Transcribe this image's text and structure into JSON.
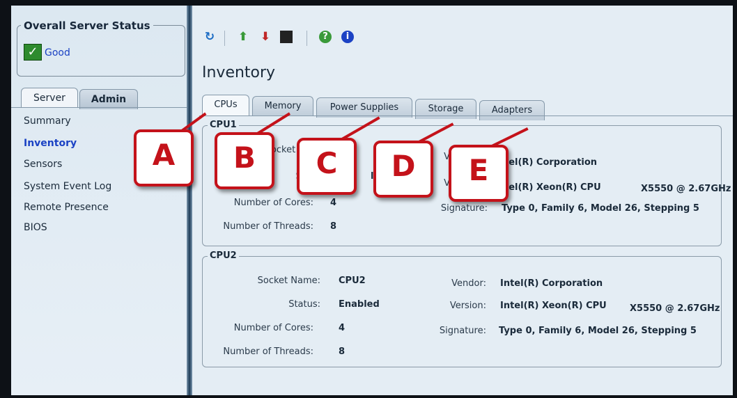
{
  "server_status": {
    "legend": "Overall Server Status",
    "value": "Good"
  },
  "sidebar": {
    "tabs": [
      {
        "label": "Server"
      },
      {
        "label": "Admin"
      }
    ],
    "items": [
      {
        "label": "Summary"
      },
      {
        "label": "Inventory"
      },
      {
        "label": "Sensors"
      },
      {
        "label": "System Event Log"
      },
      {
        "label": "Remote Presence"
      },
      {
        "label": "BIOS"
      }
    ],
    "active_item": "Inventory"
  },
  "toolbar": {
    "icons": [
      "refresh-icon",
      "power-on-icon",
      "power-off-icon",
      "console-icon",
      "help-icon",
      "info-icon"
    ]
  },
  "page_title": "Inventory",
  "tabs": [
    {
      "label": "CPUs"
    },
    {
      "label": "Memory"
    },
    {
      "label": "Power Supplies"
    },
    {
      "label": "Storage"
    },
    {
      "label": "Adapters"
    }
  ],
  "active_tab": "CPUs",
  "cpus": [
    {
      "legend": "CPU1",
      "labels": {
        "socket": "Socket Na",
        "status": "Sta",
        "cores": "Number of Cores:",
        "threads": "Number of Threads:",
        "vendor": "V",
        "version": "V",
        "signature": "Signature:"
      },
      "values": {
        "status": "led",
        "cores": "4",
        "threads": "8",
        "vendor": "tel(R) Corporation",
        "version": "tel(R) Xeon(R) CPU",
        "version_model": "X5550  @ 2.67GHz",
        "signature": "Type 0, Family 6, Model 26, Stepping 5"
      }
    },
    {
      "legend": "CPU2",
      "labels": {
        "socket": "Socket Name:",
        "status": "Status:",
        "cores": "Number of Cores:",
        "threads": "Number of Threads:",
        "vendor": "Vendor:",
        "version": "Version:",
        "signature": "Signature:"
      },
      "values": {
        "socket": "CPU2",
        "status": "Enabled",
        "cores": "4",
        "threads": "8",
        "vendor": "Intel(R) Corporation",
        "version": "Intel(R) Xeon(R) CPU",
        "version_model": "X5550  @ 2.67GHz",
        "signature": "Type 0, Family 6, Model 26, Stepping 5"
      }
    }
  ],
  "callouts": [
    {
      "letter": "A"
    },
    {
      "letter": "B"
    },
    {
      "letter": "C"
    },
    {
      "letter": "D"
    },
    {
      "letter": "E"
    }
  ],
  "colors": {
    "callout": "#c4121a",
    "link": "#1b42c4",
    "good": "#2e8b2e"
  }
}
